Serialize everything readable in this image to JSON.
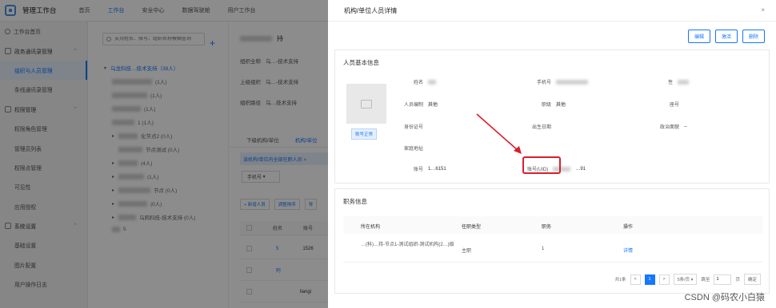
{
  "app": {
    "title": "管理工作台"
  },
  "topnav": [
    "首页",
    "工作台",
    "安全中心",
    "数据驾驶舱",
    "用户工作台"
  ],
  "topnav_active": 1,
  "sidebar": {
    "home": "工作台首页",
    "group1": "政务通讯录管理",
    "items1": [
      "组织与人员管理",
      "条线通讯录管理"
    ],
    "group2": "权限管理",
    "items2": [
      "权限角色管理",
      "管理员列表",
      "权限点管理",
      "可见性",
      "应用授权"
    ],
    "group3": "系统设置",
    "items3": [
      "基础设置",
      "图片配置",
      "用户操作日志"
    ]
  },
  "tree": {
    "search_placeholder": "支持姓名、账号、组织名称模糊查询",
    "root_label": "乌龙科技…技术支持（38人）",
    "nodes": [
      "(1人)",
      "(1人)",
      "(1人)",
      "1 (1人)",
      "化节点2 (0人)",
      "节点测试 (0人)",
      "(4人)",
      "(1人)",
      "节点 (0人)",
      "(0人)",
      "乌鸦科技-技术支持 (0人)",
      "5"
    ]
  },
  "main": {
    "title": "持",
    "kv": [
      {
        "label": "组织全称",
        "value": "乌…-技术支持"
      },
      {
        "label": "上级组织",
        "value": "乌…-技术支持"
      },
      {
        "label": "组织路径",
        "value": "乌…技术支持"
      }
    ],
    "tabs": [
      "下级机构/单位",
      "机构/单位"
    ],
    "notice": "该机构/单位内全部在职人员 >",
    "select": "手机号",
    "buttons": [
      "+ 新增人员",
      "调整排序",
      "导"
    ],
    "table_headers": [
      "姓名",
      "账号"
    ],
    "rows": [
      {
        "name": "5",
        "value": "1526"
      },
      {
        "name": "阿",
        "value": ""
      },
      {
        "name": "",
        "value": "liangi"
      }
    ]
  },
  "drawer": {
    "title": "机构/单位人员详情",
    "close": "×",
    "buttons": [
      "编辑",
      "激活",
      "删除"
    ],
    "basic_title": "人员基本信息",
    "status": "账号正常",
    "fields": [
      {
        "label": "姓名",
        "value": ""
      },
      {
        "label": "手机号",
        "value": ""
      },
      {
        "label": "性",
        "value": ""
      },
      {
        "label": "人员编制",
        "value": "其他"
      },
      {
        "label": "职级",
        "value": "其他"
      },
      {
        "label": "座号",
        "value": ""
      },
      {
        "label": "身份证号",
        "value": ""
      },
      {
        "label": "出生日期",
        "value": ""
      },
      {
        "label": "政治面貌",
        "value": "--"
      },
      {
        "label": "家庭地址",
        "value": ""
      },
      {
        "label": "账号",
        "value": "1…6151"
      },
      {
        "label": "账号(UID)",
        "value": "…91"
      }
    ],
    "job_title": "职务信息",
    "job_headers": [
      "所在机构",
      "任职类型",
      "职务",
      "操作"
    ],
    "job_row": {
      "org": "…(科)…持-节点1-测试组织-测试机构(2…)级",
      "type": "主职",
      "duty": "1",
      "action": "详情"
    },
    "pager": {
      "total": "共1条",
      "current": "1",
      "page_size": "5条/页",
      "goto": "跳至",
      "goto_value": "1",
      "page_unit": "页",
      "confirm": "确定",
      "prev": "<",
      "next": ">"
    }
  },
  "watermark": "CSDN @码农小白猿",
  "colors": {
    "accent": "#1677ff",
    "highlight": "#d9202c"
  }
}
